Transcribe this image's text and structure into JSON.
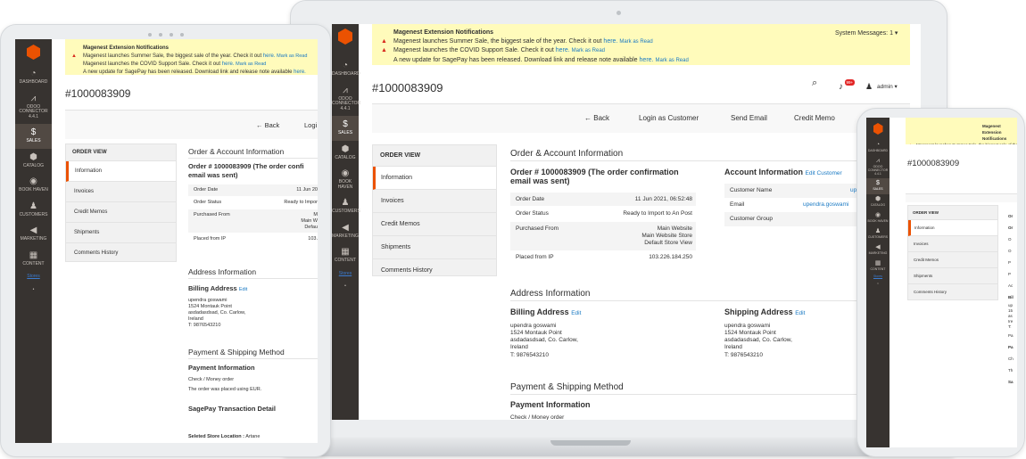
{
  "sidebar": {
    "items": [
      {
        "label": "DASHBOARD",
        "icon": "speedometer-icon"
      },
      {
        "label": "ODOO CONNECTOR 4.4.1",
        "icon": "connector-icon"
      },
      {
        "label": "SALES",
        "icon": "dollar-icon"
      },
      {
        "label": "CATALOG",
        "icon": "box-icon"
      },
      {
        "label": "BOOK HAVEN",
        "icon": "book-icon"
      },
      {
        "label": "CUSTOMERS",
        "icon": "person-icon"
      },
      {
        "label": "MARKETING",
        "icon": "megaphone-icon"
      },
      {
        "label": "CONTENT",
        "icon": "layout-icon"
      }
    ],
    "extra_link": "Stores",
    "dot": "•"
  },
  "notifications": {
    "title": "Magenest Extension Notifications",
    "messages": [
      {
        "text": "Magenest launches Summer Sale, the biggest sale of the year. Check it out",
        "link": "here.",
        "mark": "Mark as Read"
      },
      {
        "text": "Magenest launches the COVID Support Sale. Check it out",
        "link": "here.",
        "mark": "Mark as Read"
      },
      {
        "text": "A new update for SagePay has been released. Download link and release note available",
        "link": "here.",
        "mark": "Mark as Read"
      }
    ],
    "system_messages": "System Messages: 1",
    "warn_icon": "▲"
  },
  "header": {
    "title": "#1000083909",
    "admin": "admin",
    "badge": "99+"
  },
  "toolbar": {
    "back": "Back",
    "login_as_customer": "Login as Customer",
    "send_email": "Send Email",
    "credit_memo": "Credit Memo",
    "login_short": "Logi"
  },
  "tabs": {
    "heading": "ORDER VIEW",
    "items": [
      "Information",
      "Invoices",
      "Credit Memos",
      "Shipments",
      "Comments History"
    ]
  },
  "order_account": {
    "section_title": "Order & Account Information",
    "order_heading_line1": "Order # 1000083909 (The order confirmation",
    "order_heading_line2": "email was sent)",
    "order_heading_tablet": "Order # 1000083909 (The order confi",
    "rows": [
      {
        "label": "Order Date",
        "value": "11 Jun 2021, 06:52:48",
        "value_short": "11 Jun 20"
      },
      {
        "label": "Order Status",
        "value": "Ready to Import to An Post",
        "value_short": "Ready to Impor"
      },
      {
        "label": "Purchased From",
        "value_lines": [
          "Main Website",
          "Main Website Store",
          "Default Store View"
        ],
        "value_short_lines": [
          "M",
          "Main W",
          "Defau"
        ]
      },
      {
        "label": "Placed from IP",
        "value": "103.226.184.250",
        "value_short": "103."
      }
    ],
    "account_title": "Account Information",
    "account_edit": "Edit Customer",
    "account_rows": [
      {
        "label": "Customer Name",
        "value": "up"
      },
      {
        "label": "Email",
        "value": "upendra.goswami"
      },
      {
        "label": "Customer Group",
        "value": ""
      }
    ]
  },
  "address": {
    "section_title": "Address Information",
    "billing_title": "Billing Address",
    "shipping_title": "Shipping Address",
    "edit": "Edit",
    "lines": [
      "upendra goswami",
      "1524 Montauk Point",
      "asdadasdsad, Co. Carlow,",
      "Ireland",
      "T: 9876543210"
    ]
  },
  "payment": {
    "section_title": "Payment & Shipping Method",
    "info_title": "Payment Information",
    "method": "Check / Money order",
    "currency_note": "The order was placed using EUR.",
    "sagepay_title": "SagePay Transaction Detail",
    "store_location_label": "Seleted Store Location :",
    "store_location_value": "Artane"
  },
  "phone_fragments": {
    "left_col": [
      "Or",
      "Or",
      "O",
      "O",
      "P",
      "P",
      "Ac",
      "Bil",
      "up",
      "15",
      "as",
      "Ire",
      "T:",
      "Pa",
      "Pa",
      "Ch",
      "Th",
      "Sa"
    ]
  }
}
